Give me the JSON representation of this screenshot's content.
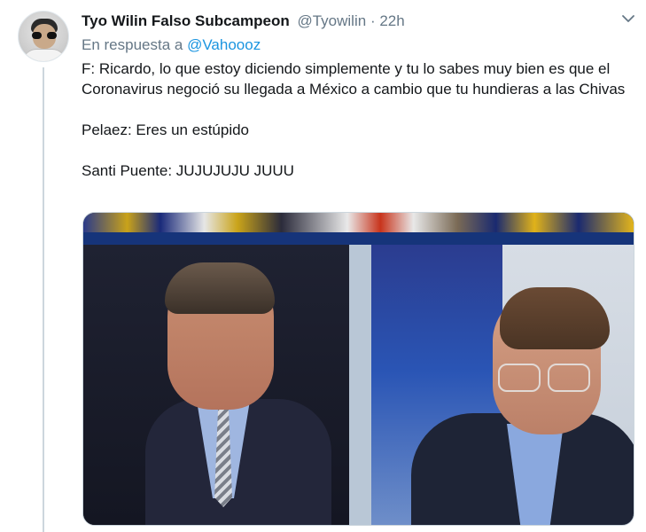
{
  "tweet": {
    "display_name": "Tyo Wilin Falso Subcampeon",
    "handle": "@Tyowilin",
    "separator": "·",
    "time": "22h",
    "reply_prefix": "En respuesta a",
    "reply_to": "@Vahoooz",
    "text_lines": [
      "F: Ricardo, lo que estoy diciendo simplemente y tu lo sabes muy bien es que el Coronavirus negoció su llegada a México a cambio que tu hundieras a las Chivas",
      "",
      "Pelaez: Eres un estúpido",
      "",
      "Santi Puente: JUJUJUJU JUUU"
    ]
  },
  "icons": {
    "avatar": "user-avatar-icon",
    "more": "chevron-down-icon"
  },
  "colors": {
    "link": "#1b95e0",
    "secondary_text": "#657786",
    "primary_text": "#14171a",
    "thread_line": "#ccd6dd"
  }
}
